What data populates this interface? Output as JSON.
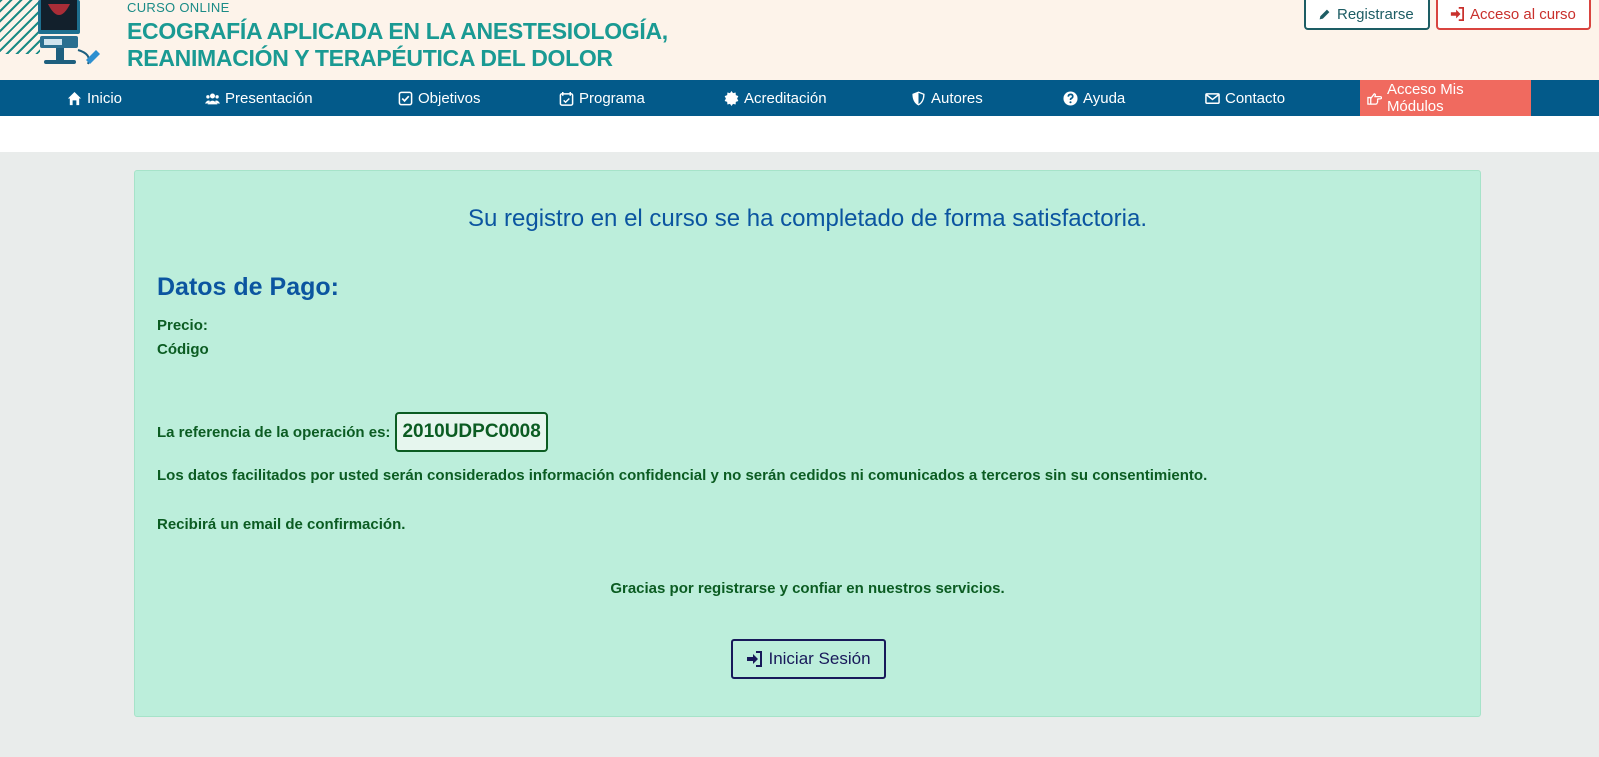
{
  "header": {
    "course_label": "CURSO ONLINE",
    "title_line1": "ECOGRAFÍA APLICADA EN LA ANESTESIOLOGÍA,",
    "title_line2": "REANIMACIÓN Y TERAPÉUTICA DEL DOLOR",
    "register_label": "Registrarse",
    "access_label": "Acceso al curso"
  },
  "nav": {
    "items": [
      {
        "label": "Inicio",
        "icon": "home-icon"
      },
      {
        "label": "Presentación",
        "icon": "users-icon"
      },
      {
        "label": "Objetivos",
        "icon": "check-square-icon"
      },
      {
        "label": "Programa",
        "icon": "calendar-check-icon"
      },
      {
        "label": "Acreditación",
        "icon": "certificate-icon"
      },
      {
        "label": "Autores",
        "icon": "shield-icon"
      },
      {
        "label": "Ayuda",
        "icon": "question-circle-icon"
      },
      {
        "label": "Contacto",
        "icon": "envelope-icon"
      },
      {
        "label": "Acceso Mis Módulos",
        "icon": "hand-point-right-icon"
      }
    ]
  },
  "main": {
    "success_message": "Su registro en el curso se ha completado de forma satisfactoria.",
    "payment_title": "Datos de Pago:",
    "price_label": "Precio:",
    "code_label": "Código",
    "reference_label": "La referencia de la operación es:",
    "reference_value": "2010UDPC0008",
    "privacy_text": "Los datos facilitados por usted serán considerados información confidencial y no serán cedidos ni comunicados a terceros sin su consentimiento.",
    "email_text": "Recibirá un email de confirmación.",
    "thanks_text": "Gracias por registrarse y confiar en nuestros servicios.",
    "login_label": "Iniciar Sesión"
  },
  "colors": {
    "nav_bg": "#035a8a",
    "modules_bg": "#f06a5f",
    "card_bg": "#bceedb",
    "title_blue": "#0b55a0",
    "text_green": "#0b5c22"
  }
}
